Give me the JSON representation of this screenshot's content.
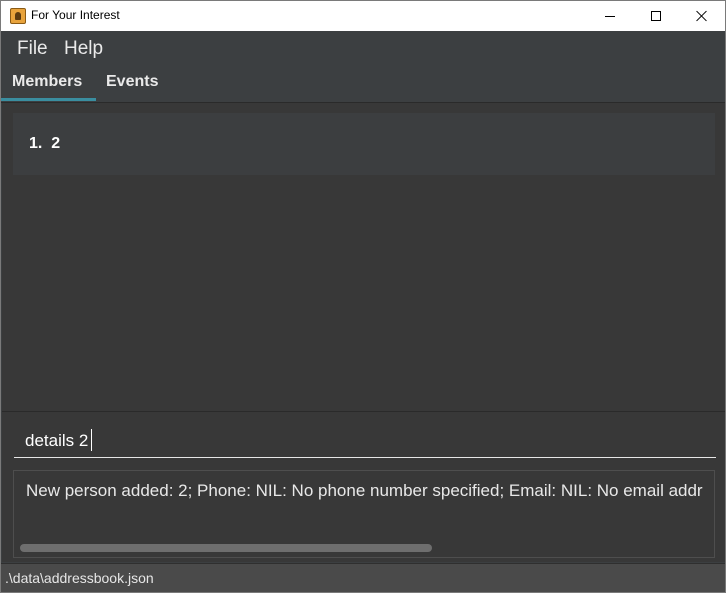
{
  "window": {
    "title": "For Your Interest",
    "icon": "app-icon"
  },
  "menu": {
    "file": "File",
    "help": "Help"
  },
  "tabs": [
    {
      "label": "Members",
      "selected": true
    },
    {
      "label": "Events",
      "selected": false
    }
  ],
  "members": {
    "items": [
      {
        "index": "1.",
        "name": "2"
      }
    ]
  },
  "command": {
    "value": "details 2"
  },
  "result": {
    "text": "New person added: 2; Phone: NIL: No phone number specified; Email: NIL: No email addr"
  },
  "status": {
    "path": ".\\data\\addressbook.json"
  },
  "colors": {
    "background": "#3c3f41",
    "tab_accent": "#3a8ea0",
    "text": "#ffffff"
  }
}
